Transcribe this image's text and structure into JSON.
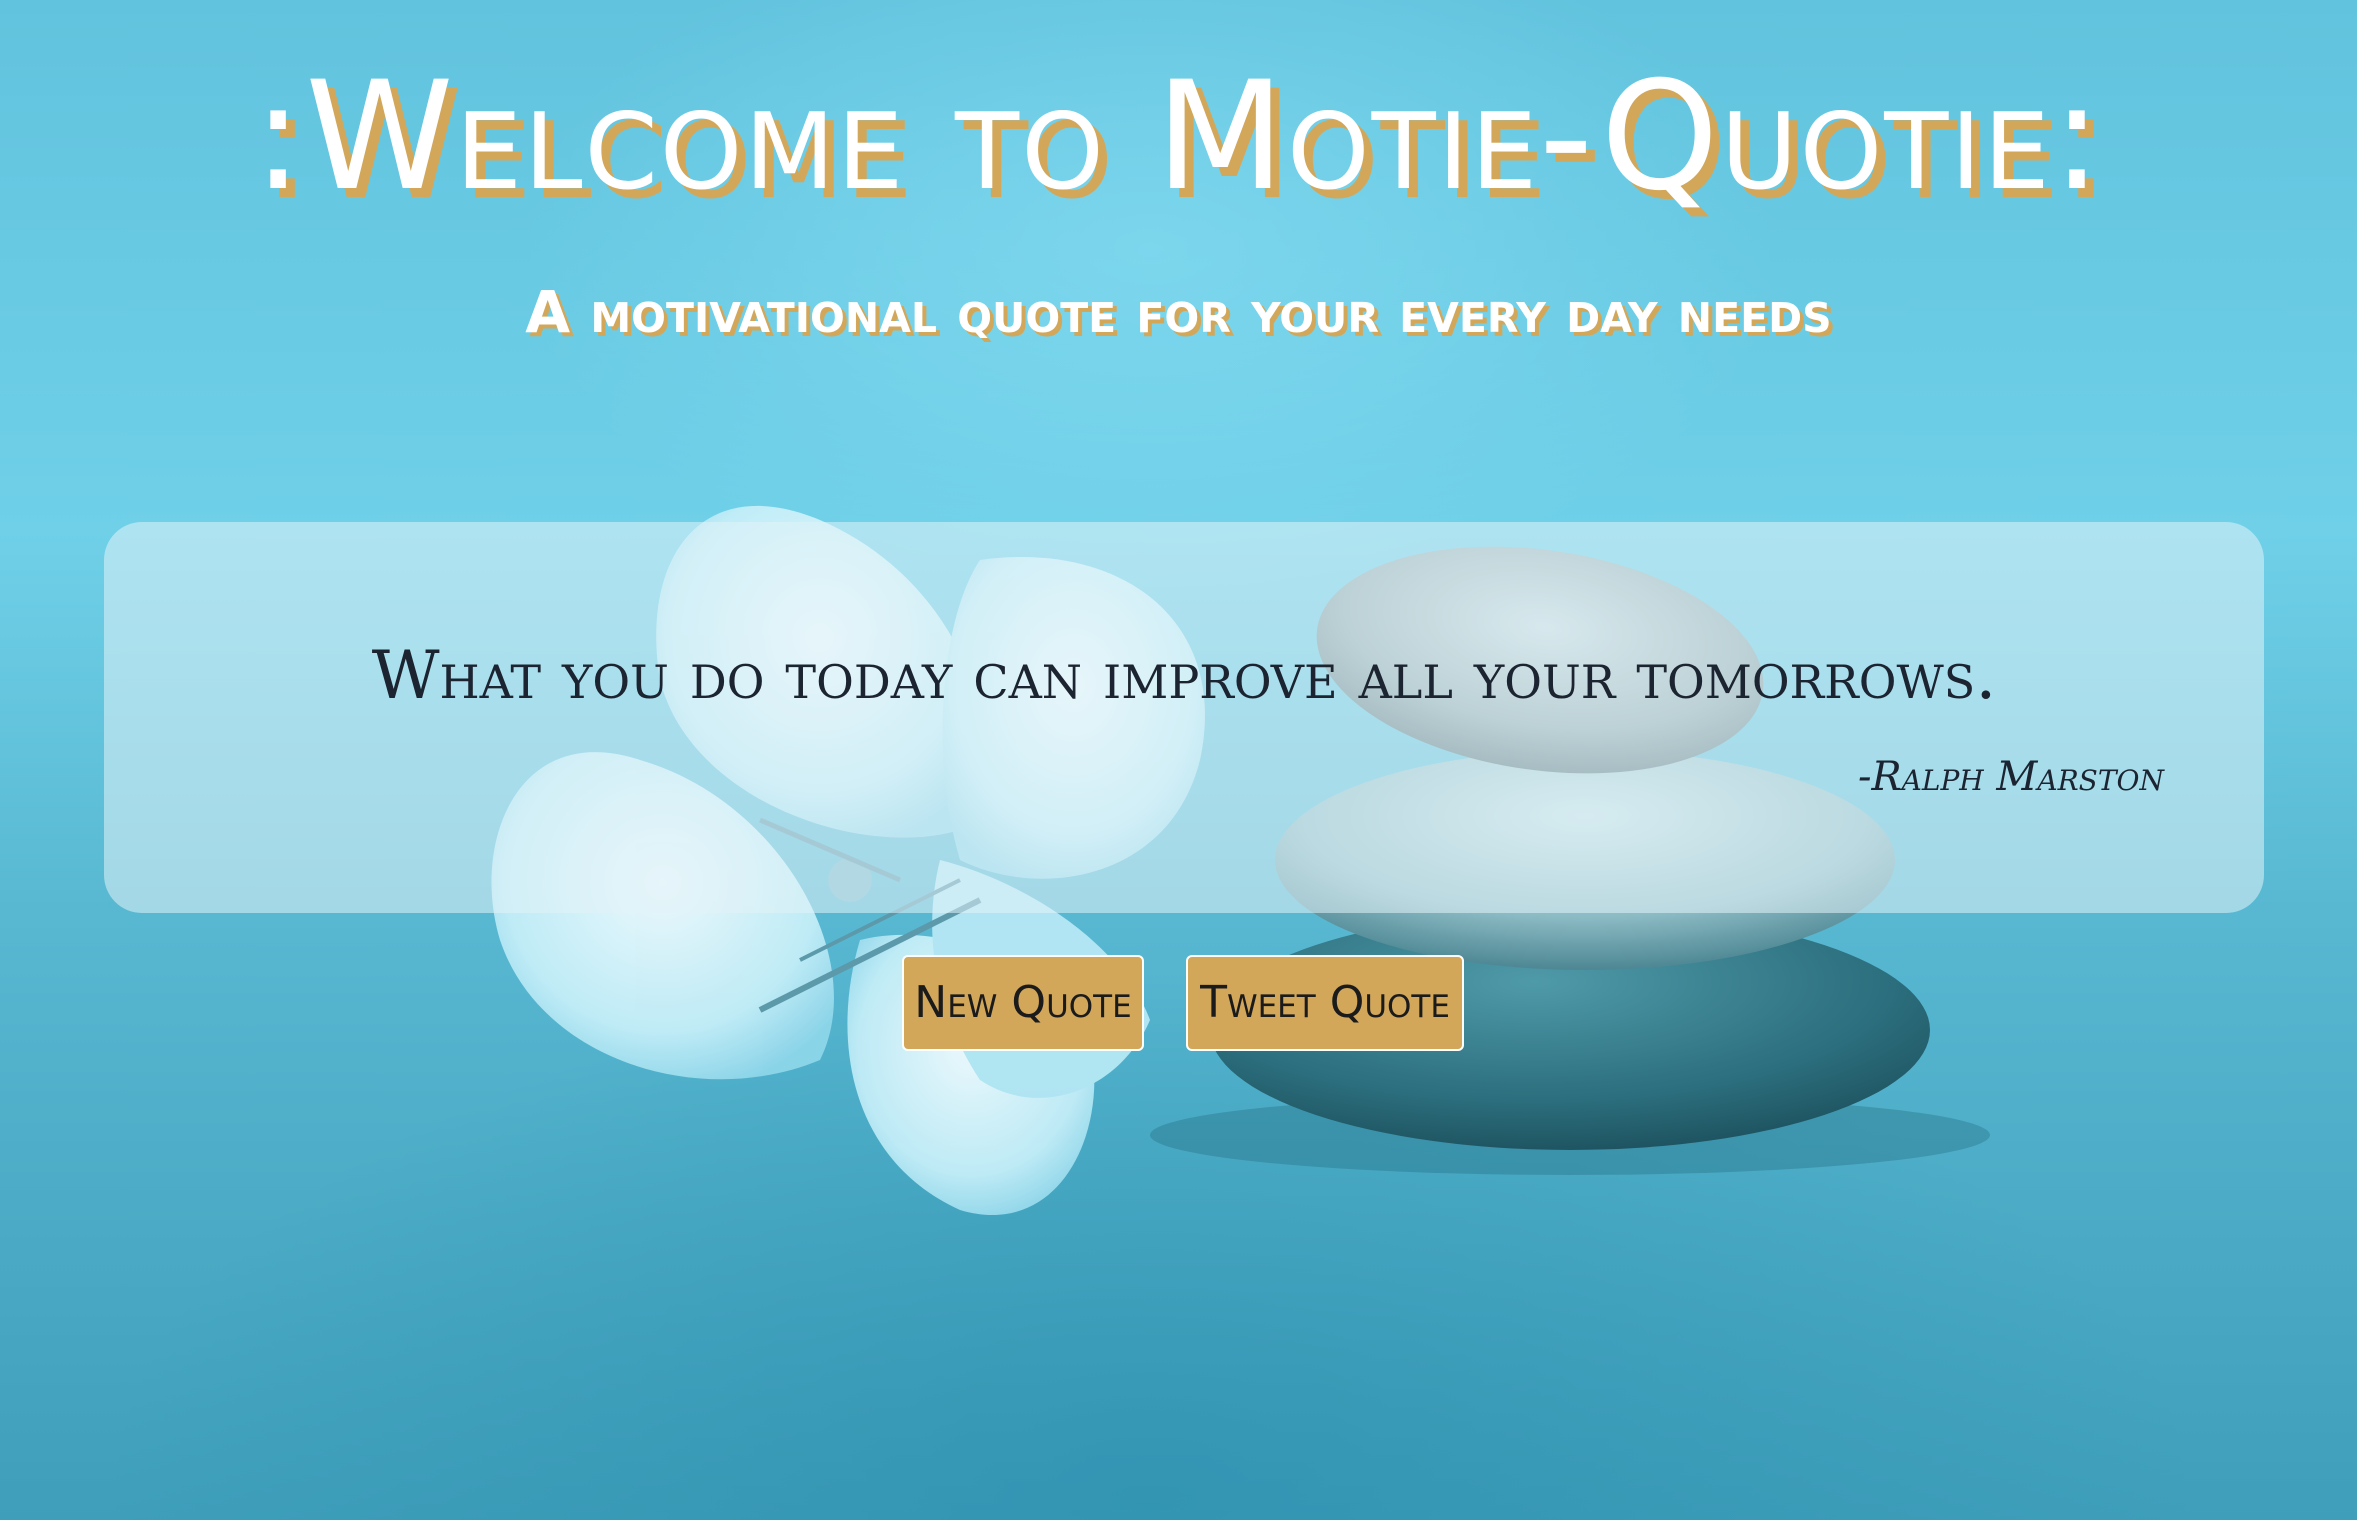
{
  "header": {
    "title": ":Welcome to Motie-Quotie:",
    "subtitle": "A motivational quote for your every day needs"
  },
  "quote": {
    "text": "What you do today can improve all your tomorrows.",
    "author": "-Ralph Marston"
  },
  "actions": {
    "new_quote_label": "New Quote",
    "tweet_quote_label": "Tweet Quote"
  },
  "colors": {
    "background": "#62c3de",
    "accent": "#d2a75a",
    "text_dark": "#1b2430",
    "title_text": "#ffffff"
  },
  "background_image": "flower-and-stacked-stones"
}
